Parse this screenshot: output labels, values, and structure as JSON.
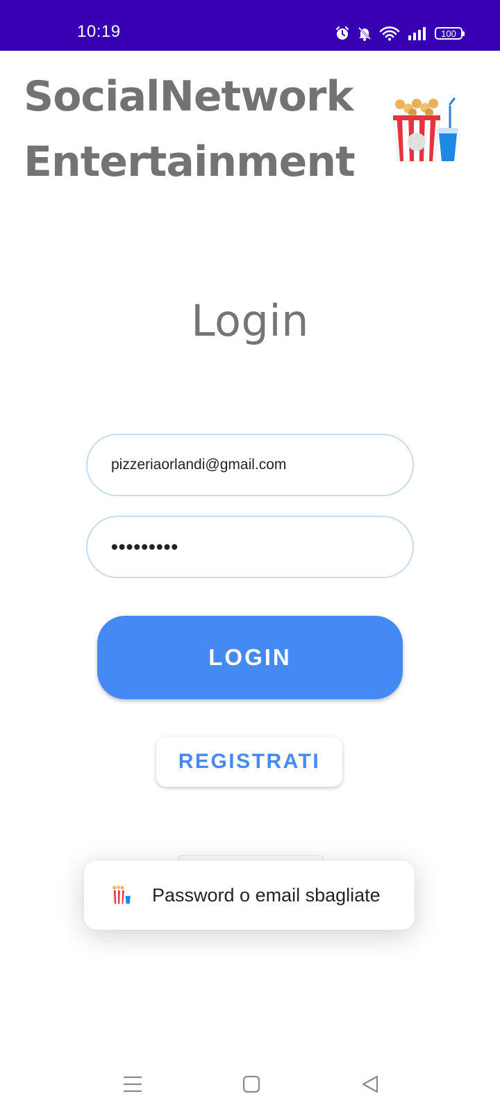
{
  "status_bar": {
    "time": "10:19",
    "battery": "100",
    "icons": [
      "alarm-icon",
      "bell-off-icon",
      "wifi-icon",
      "signal-icon",
      "battery-icon"
    ],
    "background": "#3700b3"
  },
  "header": {
    "title_line1": "SocialNetwork",
    "title_line2": "Entertainment",
    "logo_icon": "popcorn-icon"
  },
  "login": {
    "heading": "Login",
    "email_value": "pizzeriaorlandi@gmail.com",
    "password_value": "•••••••••",
    "login_button": "LOGIN",
    "register_button": "REGISTRATI"
  },
  "toast": {
    "icon": "popcorn-icon",
    "message": "Password o email sbagliate"
  },
  "nav_bar": {
    "icons": [
      "menu-icon",
      "home-icon",
      "back-icon"
    ]
  },
  "colors": {
    "primary": "#4589f5",
    "title_gray": "#737373",
    "status_bar": "#3700b3",
    "field_border": "#c6dbf1"
  }
}
